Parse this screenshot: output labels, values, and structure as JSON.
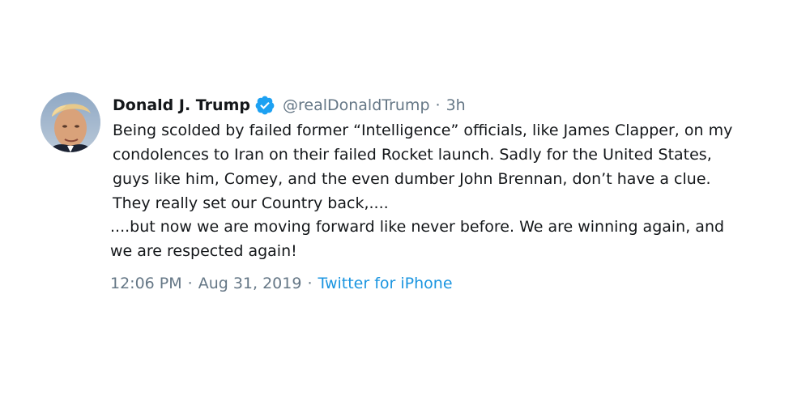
{
  "tweet": {
    "author_name": "Donald J. Trump",
    "handle": "@realDonaldTrump",
    "separator": "·",
    "relative_time": "3h",
    "text_part1": "Being scolded by failed former “Intelligence” officials, like James Clapper, on my condolences to Iran on their failed Rocket launch. Sadly for the United States, guys like him, Comey, and the even dumber John Brennan, don’t have a clue. They really set our Country back,....",
    "text_part2": "....but now we are moving forward like never before. We are winning again, and we are respected again!",
    "timestamp_time": "12:06 PM",
    "timestamp_date": "Aug 31, 2019",
    "source": "Twitter for iPhone",
    "verified": true
  },
  "icons": {
    "avatar": "avatar-photo",
    "verified": "verified-badge-icon"
  },
  "colors": {
    "name": "#14171a",
    "secondary": "#657786",
    "link": "#1b95e0",
    "verified": "#1da1f2"
  }
}
